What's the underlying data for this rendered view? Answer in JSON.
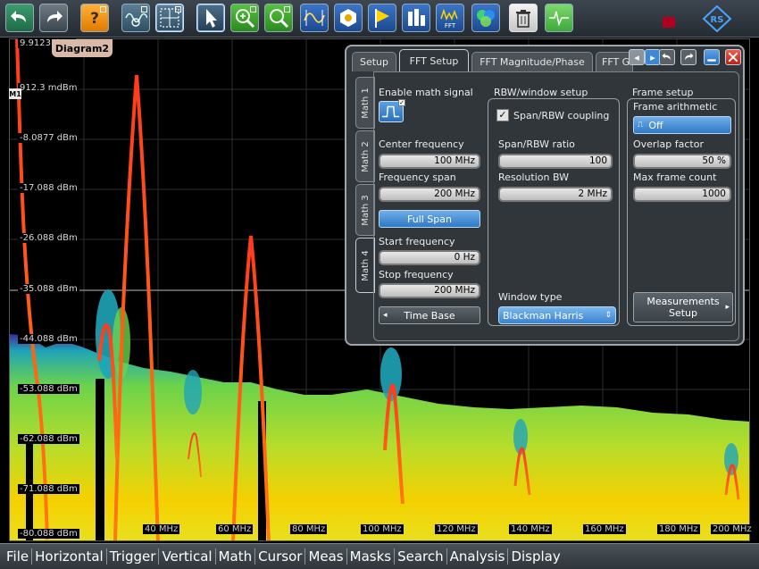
{
  "toolbar": {
    "buttons": [
      {
        "icon": "undo-arrow-icon"
      },
      {
        "icon": "redo-arrow-icon"
      },
      {
        "icon": "help-icon"
      },
      {
        "icon": "autoset-icon"
      },
      {
        "icon": "grid-layout-icon"
      },
      {
        "icon": "pointer-icon"
      },
      {
        "icon": "zoom-in-icon"
      },
      {
        "icon": "zoom-icon"
      },
      {
        "icon": "measure-wave-icon"
      },
      {
        "icon": "hexagon-icon"
      },
      {
        "icon": "flag-icon"
      },
      {
        "icon": "histogram-icon"
      },
      {
        "icon": "fft-icon"
      },
      {
        "icon": "spectrum-icon"
      },
      {
        "icon": "trash-icon"
      },
      {
        "icon": "signal-icon"
      }
    ],
    "brand_logo": "rohde-schwarz-logo-icon",
    "status_icon": "record-indicator-icon"
  },
  "diagram": {
    "tab_label": "Diagram2",
    "marker_label": "M1",
    "top_value": "9.9123 dBm",
    "y_labels": [
      "912.3 mdBm",
      "-8.0877 dBm",
      "-17.088 dBm",
      "-26.088 dBm",
      "-35.088 dBm",
      "-44.088 dBm",
      "-53.088 dBm",
      "-62.088 dBm",
      "-71.088 dBm",
      "-80.088 dBm"
    ],
    "x_labels": [
      "40 MHz",
      "60 MHz",
      "80 MHz",
      "100 MHz",
      "120 MHz",
      "140 MHz",
      "160 MHz",
      "180 MHz",
      "200 MHz"
    ],
    "colors": {
      "trace": "#ff3b1f",
      "dense": "#f5d000",
      "mid": "#6cd34a",
      "sparse": "#1fa4b8",
      "edge": "#3b2b9e"
    }
  },
  "dialog": {
    "tabs": [
      "Setup",
      "FFT Setup",
      "FFT Magnitude/Phase",
      "FFT G"
    ],
    "active_tab": "FFT Setup",
    "side_tabs": [
      "Math 1",
      "Math 2",
      "Math 3",
      "Math 4"
    ],
    "active_side_tab": "Math 4",
    "left": {
      "enable_label": "Enable math signal",
      "center_freq_label": "Center frequency",
      "center_freq_value": "100 MHz",
      "span_label": "Frequency span",
      "span_value": "200 MHz",
      "full_span_label": "Full Span",
      "start_label": "Start frequency",
      "start_value": "0 Hz",
      "stop_label": "Stop frequency",
      "stop_value": "200 MHz",
      "time_base_label": "Time Base"
    },
    "rbw": {
      "title": "RBW/window setup",
      "coupling_label": "Span/RBW coupling",
      "ratio_label": "Span/RBW ratio",
      "ratio_value": "100",
      "res_label": "Resolution BW",
      "res_value": "2 MHz",
      "window_label": "Window type",
      "window_value": "Blackman Harris"
    },
    "frame": {
      "title": "Frame setup",
      "arith_label": "Frame arithmetic",
      "arith_value": "Off",
      "overlap_label": "Overlap factor",
      "overlap_value": "50 %",
      "max_label": "Max frame count",
      "max_value": "1000",
      "meas_label": "Measurements Setup"
    }
  },
  "menu": [
    "File",
    "Horizontal",
    "Trigger",
    "Vertical",
    "Math",
    "Cursor",
    "Meas",
    "Masks",
    "Search",
    "Analysis",
    "Display"
  ]
}
